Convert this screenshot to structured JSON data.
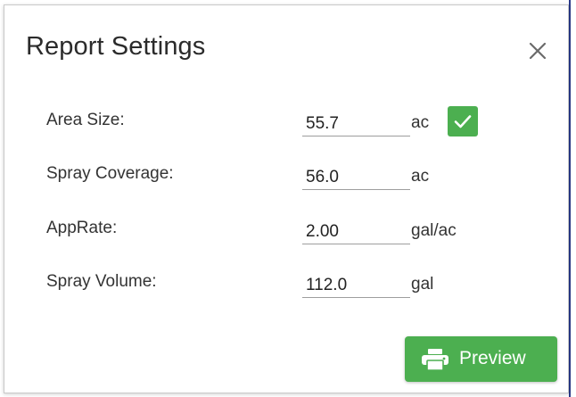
{
  "dialog": {
    "title": "Report Settings",
    "close_icon": "close-icon",
    "fields": [
      {
        "label": "Area Size:",
        "value": "55.7",
        "unit": "ac"
      },
      {
        "label": "Spray Coverage:",
        "value": "56.0",
        "unit": "ac"
      },
      {
        "label": "AppRate:",
        "value": "2.00",
        "unit": "gal/ac"
      },
      {
        "label": "Spray Volume:",
        "value": "112.0",
        "unit": "gal"
      }
    ],
    "confirm_icon": "checkmark-icon",
    "preview_button": {
      "label": "Preview",
      "icon": "printer-icon"
    }
  },
  "colors": {
    "accent_green": "#4caf50",
    "text_dark": "#2b2b2b",
    "underline": "#9e9e9e"
  }
}
